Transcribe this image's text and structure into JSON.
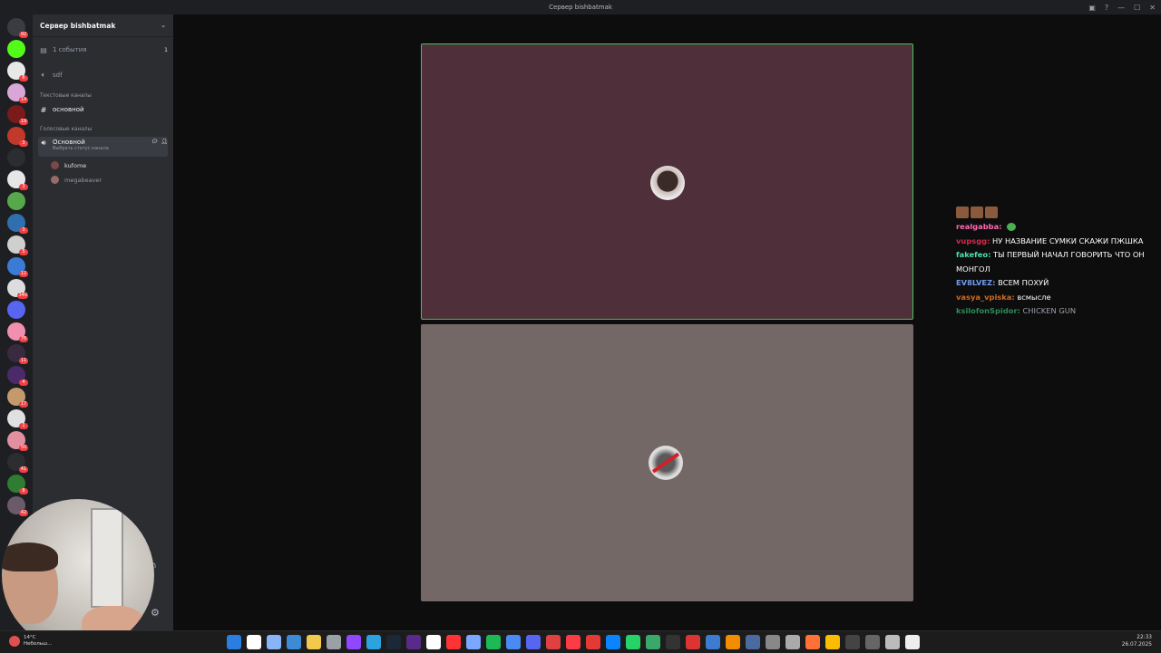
{
  "window": {
    "title": "Сервер bishbatmak"
  },
  "rail": {
    "servers": [
      {
        "name": "home",
        "color": "#3a3c42",
        "badge": "92"
      },
      {
        "name": "kick",
        "color": "#53fc18",
        "badge": ""
      },
      {
        "name": "s",
        "color": "#e8e8e8",
        "badge": "6"
      },
      {
        "name": "anime",
        "color": "#d8a7d8",
        "badge": "14"
      },
      {
        "name": "red",
        "color": "#7a1a1a",
        "badge": "19"
      },
      {
        "name": "tools",
        "color": "#c0392b",
        "badge": "3"
      },
      {
        "name": "x",
        "color": "#2b2d31",
        "badge": ""
      },
      {
        "name": "v",
        "color": "#e6e6e6",
        "badge": "3"
      },
      {
        "name": "green",
        "color": "#57a84b",
        "badge": ""
      },
      {
        "name": "blue",
        "color": "#2f6fb0",
        "badge": "3"
      },
      {
        "name": "gear",
        "color": "#cfcfcf",
        "badge": "5"
      },
      {
        "name": "globe",
        "color": "#3a7bd5",
        "badge": "12"
      },
      {
        "name": "img",
        "color": "#dddddd",
        "badge": "340"
      },
      {
        "name": "сервер",
        "color": "#5865f2",
        "badge": ""
      },
      {
        "name": "pink",
        "color": "#f08fb0",
        "badge": "76"
      },
      {
        "name": "rdr",
        "color": "#3a2a40",
        "badge": "11"
      },
      {
        "name": "high",
        "color": "#4b2a6a",
        "badge": "4"
      },
      {
        "name": "face",
        "color": "#c49a6c",
        "badge": "17"
      },
      {
        "name": "clock",
        "color": "#e0e0e0",
        "badge": "1"
      },
      {
        "name": "girls",
        "color": "#e28fa0",
        "badge": "50"
      },
      {
        "name": "txt",
        "color": "#2b2d31",
        "badge": "41"
      },
      {
        "name": "green2",
        "color": "#2e7d32",
        "badge": "8"
      },
      {
        "name": "dark",
        "color": "#6a5a6a",
        "badge": "42"
      }
    ]
  },
  "sidebar": {
    "server_name": "Сервер bishbatmak",
    "events_label": "1 события",
    "events_count": "1",
    "channel_sdf": "sdf",
    "text_category": "Текстовые каналы",
    "text_channel": "основной",
    "voice_category": "Голосовые каналы",
    "voice_channel": "Основной",
    "voice_status": "Выбрать статус канала",
    "users": [
      {
        "name": "kufome",
        "color": "#7a4a4a"
      },
      {
        "name": "megabeaver",
        "color": "#9a6a6a"
      }
    ]
  },
  "chat": {
    "lines": [
      {
        "user": "realgabba:",
        "color": "#ff69b4",
        "text": "",
        "emoji": true
      },
      {
        "user": "vupsgg:",
        "color": "#d12a4a",
        "text": "НУ НАЗВАНИЕ СУМКИ СКАЖИ ПЖШКА"
      },
      {
        "user": "fakefeo:",
        "color": "#4fe0b0",
        "text": "ТЫ ПЕРВЫЙ НАЧАЛ ГОВОРИТЬ ЧТО ОН МОНГОЛ"
      },
      {
        "user": "EV8LVEZ:",
        "color": "#6f9cf0",
        "text": "ВСЕМ ПОХУЙ"
      },
      {
        "user": "vasya_vpiska:",
        "color": "#d2691e",
        "text": "всмысле"
      },
      {
        "user": "ksilofonSpidor:",
        "color": "#2e8b57",
        "text": "CHICKEN GUN"
      }
    ]
  },
  "taskbar": {
    "weather_temp": "14°C",
    "weather_text": "Небольш...",
    "time": "22:33",
    "date": "26.07.2025",
    "icons": [
      "windows-icon",
      "search-icon",
      "taskview-icon",
      "widgets-icon",
      "explorer-icon",
      "settings-icon",
      "twitch-icon",
      "telegram-icon",
      "steam-icon",
      "obs-icon",
      "calendar-icon",
      "yandex-icon",
      "mail-icon",
      "spotify-icon",
      "browser-icon",
      "discord-icon",
      "app-icon",
      "music-icon",
      "b-icon",
      "photos-icon",
      "whatsapp-icon",
      "tool-icon",
      "terminal-icon",
      "64-icon",
      "vscode-icon",
      "vlc-icon",
      "network-icon",
      "app2-icon",
      "apps-icon",
      "firefox-icon",
      "chrome-icon",
      "screen-icon",
      "window-icon",
      "update-icon",
      "tray-icon"
    ]
  }
}
